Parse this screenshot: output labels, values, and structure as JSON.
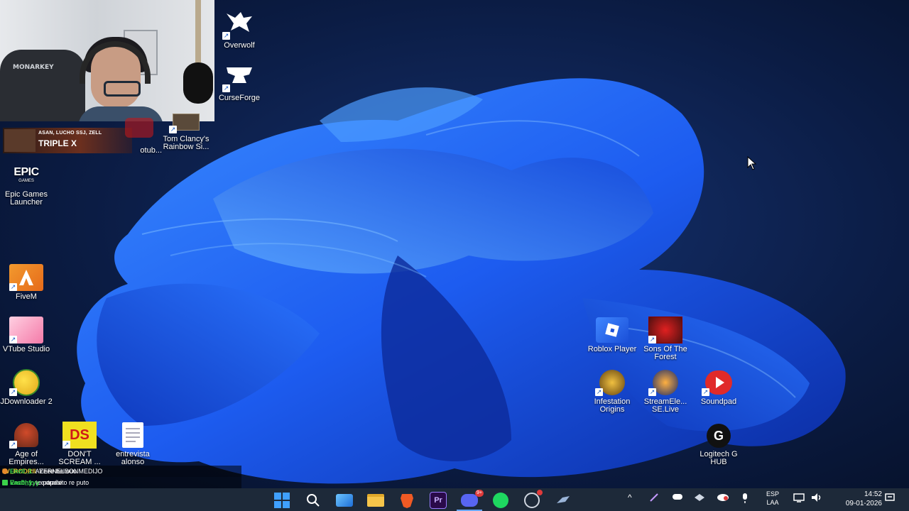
{
  "desktop": {
    "icons": [
      {
        "label": "Overwolf",
        "icon": "overwolf-icon"
      },
      {
        "label": "CurseForge",
        "icon": "curseforge-icon"
      },
      {
        "label": "otub...",
        "icon": "youtube-icon"
      },
      {
        "label": "Tom Clancy's Rainbow Si...",
        "icon": "rainbow-six-icon"
      },
      {
        "label": "Epic Games Launcher",
        "icon": "epic-games-icon"
      },
      {
        "label": "FiveM",
        "icon": "fivem-icon"
      },
      {
        "label": "VTube Studio",
        "icon": "vtube-studio-icon"
      },
      {
        "label": "JDownloader 2",
        "icon": "jdownloader-icon"
      },
      {
        "label": "Age of Empires...",
        "icon": "age-of-empires-icon"
      },
      {
        "label": "DON'T SCREAM ...",
        "icon": "dont-scream-icon"
      },
      {
        "label": "entrevista alonso",
        "icon": "document-icon"
      },
      {
        "label": "Roblox Player",
        "icon": "roblox-icon"
      },
      {
        "label": "Sons Of The Forest",
        "icon": "sons-of-the-forest-icon"
      },
      {
        "label": "Infestation Origins",
        "icon": "infestation-icon"
      },
      {
        "label": "StreamEle... SE.Live",
        "icon": "streamelements-icon"
      },
      {
        "label": "Soundpad",
        "icon": "soundpad-icon"
      },
      {
        "label": "Logitech G HUB",
        "icon": "logitech-ghub-icon"
      }
    ],
    "epic_logo_text": "EPIC",
    "epic_logo_sub": "GAMES",
    "dont_scream_logo": "DS"
  },
  "stream_overlay": {
    "names": "ASAN, LUCHO SSJ, ZELL",
    "title": "TRIPLE X",
    "chair_brand": "MONARKEY"
  },
  "chat": [
    {
      "user": "LV_RODRII",
      "message": ": Eeee hellouu",
      "color": "#e0c030"
    },
    {
      "user": "Enz0_1",
      "message": ": teextrañe",
      "color": "#3bd14a"
    },
    {
      "user": "Enz0_1",
      "message": ": AYERNELSONMEDIJO",
      "color": "#ffffff"
    },
    {
      "user": "Vashhyyy",
      "message": ": papasito re puto",
      "color": "#3bd14a"
    }
  ],
  "taskbar": {
    "apps": [
      "windows-start-icon",
      "search-icon",
      "photos-icon",
      "file-explorer-icon",
      "brave-icon",
      "premiere-pro-icon",
      "discord-icon",
      "spotify-icon",
      "steam-like-icon",
      "app-icon"
    ],
    "premiere_label": "Pr",
    "discord_badge": "9+",
    "language": "ESP",
    "layout": "LAA",
    "time": "14:52",
    "date": "09-01-2026",
    "chevron": "^"
  },
  "colors": {
    "accent": "#1b5cc8",
    "taskbar": "#202a3a"
  }
}
